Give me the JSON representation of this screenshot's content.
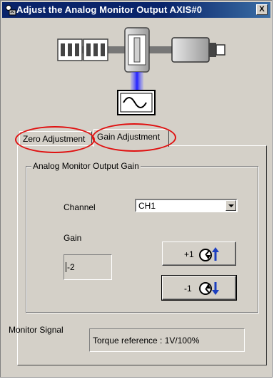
{
  "window": {
    "title": "Adjust the Analog Monitor Output AXIS#0",
    "close_label": "X"
  },
  "tabs": [
    {
      "label": "Zero Adjustment",
      "active": false
    },
    {
      "label": "Gain Adjustment",
      "active": true
    }
  ],
  "group": {
    "title": "Analog Monitor Output Gain"
  },
  "channel": {
    "label": "Channel",
    "value": "CH1"
  },
  "gain": {
    "label": "Gain",
    "value": "-2"
  },
  "buttons": {
    "increase_label": "+1",
    "decrease_label": "-1"
  },
  "monitor": {
    "label": "Monitor Signal",
    "value": "Torque reference : 1V/100%"
  },
  "colors": {
    "titlebar": "#0a246a",
    "highlight": "#e01010",
    "arrow": "#1c3fbf",
    "signal_glow": "#2020ff"
  },
  "icons": [
    "window-app-icon",
    "servo-drive-icon",
    "servomotor-icon",
    "oscilloscope-icon",
    "gain-up-icon",
    "gain-down-icon"
  ]
}
